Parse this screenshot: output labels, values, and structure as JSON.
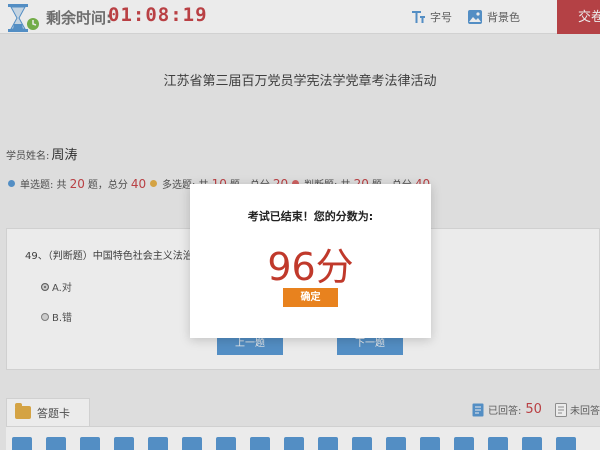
{
  "header": {
    "timer_label": "剩余时间:",
    "timer_value": "01:08:19",
    "font_size_label": "字号",
    "background_label": "背景色",
    "submit_label": "交卷"
  },
  "exam": {
    "title": "江苏省第三届百万党员学宪法学党章考法律活动"
  },
  "student": {
    "label": "学员姓名:",
    "name": "周涛"
  },
  "summary": [
    {
      "type": "单选题",
      "prefix": ": 共",
      "count": "20",
      "unit": "题，总分",
      "total": "40",
      "color": "#5b9bd5"
    },
    {
      "type": "多选题",
      "prefix": ": 共",
      "count": "10",
      "unit": "题，总分",
      "total": "20",
      "color": "#e7b14a"
    },
    {
      "type": "判断题",
      "prefix": ": 共",
      "count": "20",
      "unit": "题，总分",
      "total": "40",
      "color": "#e06b6b"
    }
  ],
  "question": {
    "text": "49、（判断题）中国特色社会主义法治道路",
    "option_a": "A.对",
    "option_b": "B.错",
    "prev_label": "上一题",
    "next_label": "下一题"
  },
  "answer_card": {
    "tab_label": "答题卡",
    "answered_label": "已回答:",
    "answered_count": "50",
    "unanswered_label": "未回答"
  },
  "modal": {
    "message": "考试已结束！您的分数为:",
    "score": "96分",
    "confirm_label": "确定"
  },
  "colors": {
    "accent_red": "#c9464a",
    "blue": "#5b9bd5",
    "orange": "#e8821e"
  }
}
